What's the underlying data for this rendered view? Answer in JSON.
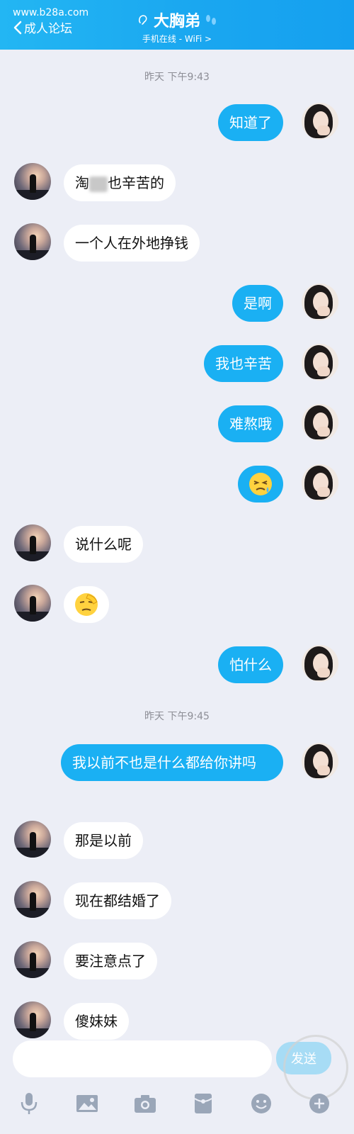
{
  "header": {
    "watermark": "www.b28a.com",
    "back_label": "成人论坛",
    "title": "大胸弟",
    "subtitle": "手机在线 - WiFi >",
    "icons": [
      "ear-icon",
      "footprints-icon",
      "chevron-left-icon"
    ]
  },
  "timestamps": [
    "昨天 下午9:43",
    "昨天 下午9:45"
  ],
  "messages": [
    {
      "side": "out",
      "text": "知道了"
    },
    {
      "side": "in",
      "text_a": "淘",
      "text_b": "也辛苦的"
    },
    {
      "side": "in",
      "text": "一个人在外地挣钱"
    },
    {
      "side": "out",
      "text": "是啊"
    },
    {
      "side": "out",
      "text": "我也辛苦"
    },
    {
      "side": "out",
      "text": "难熬哦"
    },
    {
      "side": "out",
      "emoji": "sad-sweat-emoji"
    },
    {
      "side": "in",
      "text": "说什么呢"
    },
    {
      "side": "in",
      "emoji": "facepalm-emoji"
    },
    {
      "side": "out",
      "text": "怕什么"
    },
    {
      "side": "out",
      "text": "我以前不也是什么都给你讲吗"
    },
    {
      "side": "in",
      "text": "那是以前"
    },
    {
      "side": "in",
      "text": "现在都结婚了"
    },
    {
      "side": "in",
      "text": "要注意点了"
    },
    {
      "side": "in",
      "text": "傻妹妹"
    }
  ],
  "composer": {
    "input_value": "",
    "send_label": "发送"
  },
  "toolbar": {
    "icons": [
      "microphone-icon",
      "image-icon",
      "camera-icon",
      "red-packet-icon",
      "emoji-icon",
      "plus-icon"
    ]
  },
  "colors": {
    "header": "#1aa7f0",
    "bubble_out": "#1ab0f3",
    "bubble_in": "#ffffff",
    "background": "#eceef6"
  }
}
